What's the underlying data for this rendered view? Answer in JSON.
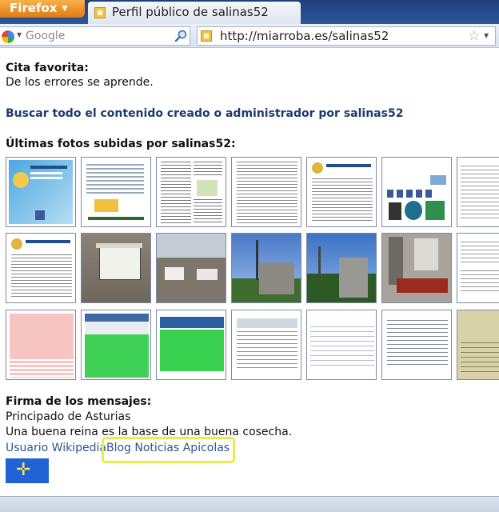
{
  "browser": {
    "menu_button": "Firefox",
    "tab_title": "Perfil público de salinas52",
    "search_placeholder": "Google",
    "url": "http://miarroba.es/salinas52"
  },
  "profile": {
    "quote_heading": "Cita favorita:",
    "quote_text": "De los errores se aprende.",
    "search_link": "Buscar todo el contenido creado o administrador por salinas52",
    "photos_heading": "Últimas fotos subidas por salinas52:",
    "signature_heading": "Firma de los mensajes:",
    "signature_lines": [
      "Principado de Asturias",
      "Una buena reina es la base de una buena cosecha."
    ],
    "links": [
      "Usuario Wikipedia",
      "Blog Noticias Apicolas"
    ]
  },
  "colors": {
    "highlight": "#e4ee4f",
    "link": "#1d3b6e",
    "flag": "#1f63d6"
  }
}
